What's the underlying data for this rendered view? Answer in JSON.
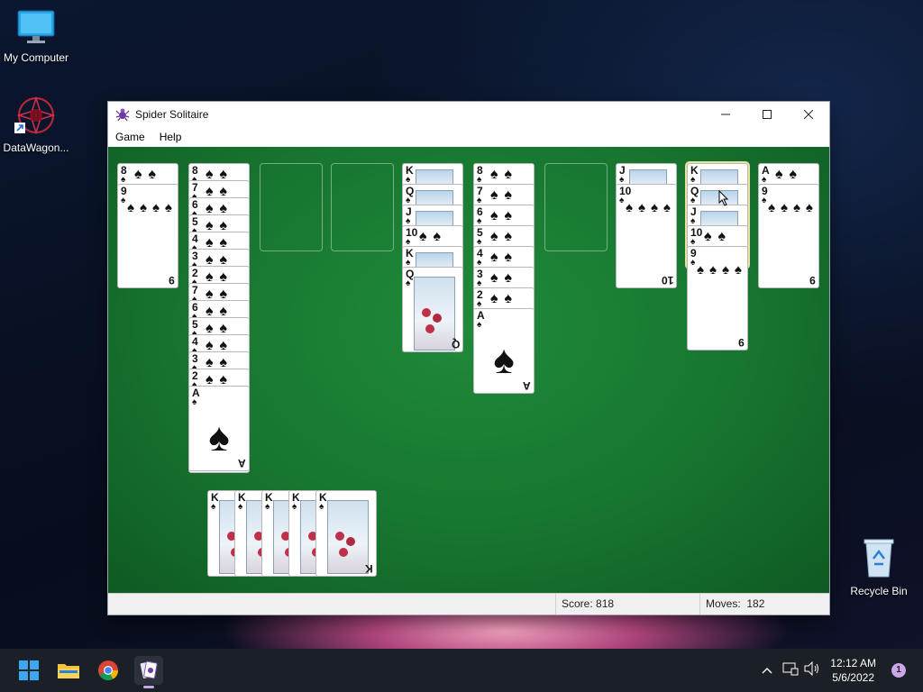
{
  "desktop": {
    "icons": [
      {
        "label": "My Computer"
      },
      {
        "label": "DataWagon..."
      },
      {
        "label": "Recycle Bin"
      }
    ]
  },
  "window": {
    "title": "Spider Solitaire",
    "menu": [
      "Game",
      "Help"
    ]
  },
  "game": {
    "suit_symbol": "♠",
    "piles": [
      {
        "cards": [
          "8",
          "9"
        ]
      },
      {
        "cards": [
          "8",
          "7",
          "6",
          "5",
          "4",
          "3",
          "2",
          "7",
          "6",
          "5",
          "4",
          "3",
          "2",
          "A"
        ]
      },
      {
        "cards": []
      },
      {
        "cards": []
      },
      {
        "cards": [
          "K",
          "Q",
          "J",
          "10",
          "K",
          "Q"
        ]
      },
      {
        "cards": [
          "8",
          "7",
          "6",
          "5",
          "4",
          "3",
          "2",
          "A"
        ]
      },
      {
        "cards": []
      },
      {
        "cards": [
          "J",
          "10"
        ]
      },
      {
        "cards": [
          "K",
          "Q",
          "J",
          "10",
          "9"
        ]
      },
      {
        "cards": [
          "A",
          "9"
        ]
      }
    ],
    "stock": [
      "K",
      "K",
      "K",
      "K",
      "K"
    ]
  },
  "status": {
    "score_label": "Score:",
    "score": "818",
    "moves_label": "Moves:",
    "moves": "182"
  },
  "taskbar": {
    "time": "12:12 AM",
    "date": "5/6/2022",
    "notifications": "1"
  }
}
